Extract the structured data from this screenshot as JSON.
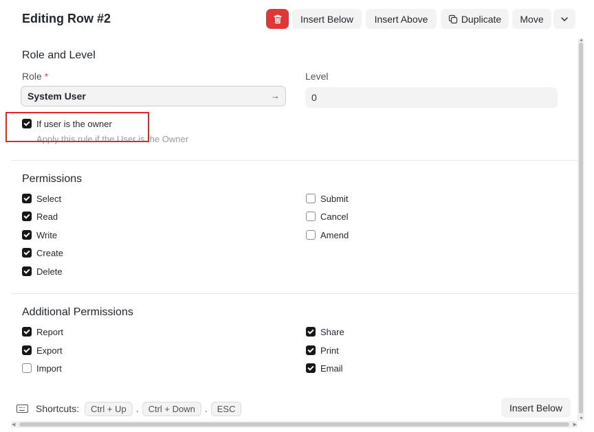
{
  "header": {
    "title": "Editing Row #2",
    "buttons": {
      "delete_icon": "trash-icon",
      "insert_below": "Insert Below",
      "insert_above": "Insert Above",
      "duplicate": "Duplicate",
      "move": "Move",
      "more_icon": "chevron-down-icon"
    }
  },
  "role_section": {
    "title": "Role and Level",
    "role_label": "Role",
    "required_mark": "*",
    "role_value": "System User",
    "level_label": "Level",
    "level_value": "0",
    "owner_checkbox": {
      "label": "If user is the owner",
      "checked": true
    },
    "owner_description": "Apply this rule if the User is the Owner"
  },
  "permissions": {
    "title": "Permissions",
    "left": [
      {
        "label": "Select",
        "checked": true
      },
      {
        "label": "Read",
        "checked": true
      },
      {
        "label": "Write",
        "checked": true
      },
      {
        "label": "Create",
        "checked": true
      },
      {
        "label": "Delete",
        "checked": true
      }
    ],
    "right": [
      {
        "label": "Submit",
        "checked": false
      },
      {
        "label": "Cancel",
        "checked": false
      },
      {
        "label": "Amend",
        "checked": false
      }
    ]
  },
  "additional_permissions": {
    "title": "Additional Permissions",
    "left": [
      {
        "label": "Report",
        "checked": true
      },
      {
        "label": "Export",
        "checked": true
      },
      {
        "label": "Import",
        "checked": false
      }
    ],
    "right": [
      {
        "label": "Share",
        "checked": true
      },
      {
        "label": "Print",
        "checked": true
      },
      {
        "label": "Email",
        "checked": true
      }
    ]
  },
  "footer": {
    "shortcuts_label": "Shortcuts:",
    "keys": [
      "Ctrl + Up",
      "Ctrl + Down",
      "ESC"
    ],
    "separator": ".",
    "insert_below": "Insert Below"
  },
  "colors": {
    "danger": "#e03636",
    "highlight": "#e0262a",
    "checked": "#171717"
  }
}
